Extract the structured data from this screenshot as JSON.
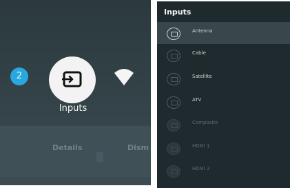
{
  "left": {
    "badge_count": "2",
    "tile_label": "Inputs",
    "actions": {
      "details": "Details",
      "dismiss": "Dism"
    }
  },
  "right": {
    "title": "Inputs",
    "items": [
      {
        "label": "Antenna",
        "state": "selected"
      },
      {
        "label": "Cable",
        "state": "normal"
      },
      {
        "label": "Satellite",
        "state": "normal"
      },
      {
        "label": "ATV",
        "state": "normal"
      },
      {
        "label": "Composite",
        "state": "dim"
      },
      {
        "label": "HDMI 1",
        "state": "dim"
      },
      {
        "label": "HDMI 2",
        "state": "dim"
      }
    ]
  },
  "colors": {
    "accent": "#29a7df",
    "panel_dark": "#1f2a2e",
    "selected_row": "#39464b"
  },
  "icons": [
    "input-source-icon",
    "wifi-icon"
  ]
}
